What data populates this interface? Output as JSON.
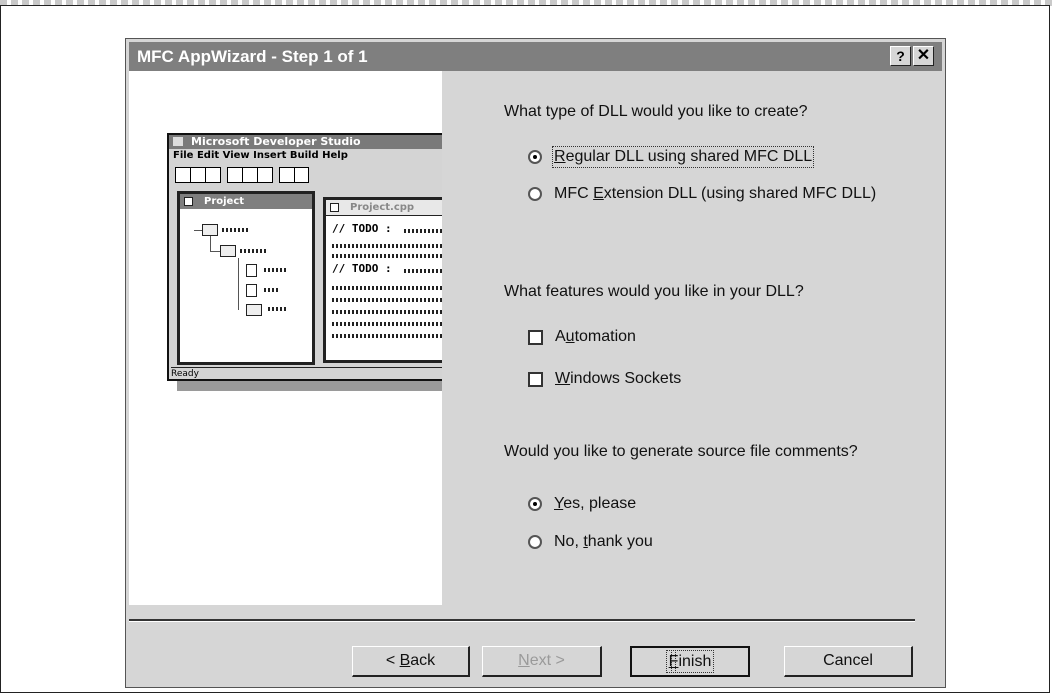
{
  "window": {
    "title": "MFC AppWizard - Step 1 of 1",
    "help_button": "?",
    "close_button": "✕"
  },
  "illustration": {
    "title": "Microsoft Developer Studio",
    "menu": "File Edit View Insert Build Help",
    "project_window_title": "Project",
    "code_window_title": "Project.cpp",
    "todo_1": "// TODO :",
    "todo_2": "// TODO :",
    "status": "Ready"
  },
  "dll_type": {
    "question": "What type of DLL would you like to create?",
    "options": [
      {
        "label_pre": "",
        "accel": "R",
        "label_post": "egular DLL using shared MFC DLL",
        "selected": true
      },
      {
        "label_pre": "MFC ",
        "accel": "E",
        "label_post": "xtension DLL (using shared MFC DLL)",
        "selected": false
      }
    ]
  },
  "features": {
    "question": "What features would you like in your DLL?",
    "options": [
      {
        "label_pre": "A",
        "accel": "u",
        "label_post": "tomation",
        "checked": false
      },
      {
        "label_pre": "",
        "accel": "W",
        "label_post": "indows Sockets",
        "checked": false
      }
    ]
  },
  "comments": {
    "question": "Would you like to generate source file comments?",
    "options": [
      {
        "label_pre": "",
        "accel": "Y",
        "label_post": "es, please",
        "selected": true
      },
      {
        "label_pre": "No, ",
        "accel": "t",
        "label_post": "hank you",
        "selected": false
      }
    ]
  },
  "buttons": {
    "back": {
      "pre": "< ",
      "accel": "B",
      "post": "ack",
      "enabled": true
    },
    "next": {
      "pre": "",
      "accel": "N",
      "post": "ext >",
      "enabled": false
    },
    "finish": {
      "pre": "",
      "accel": "F",
      "post": "inish",
      "enabled": true
    },
    "cancel": {
      "label": "Cancel",
      "enabled": true
    }
  }
}
